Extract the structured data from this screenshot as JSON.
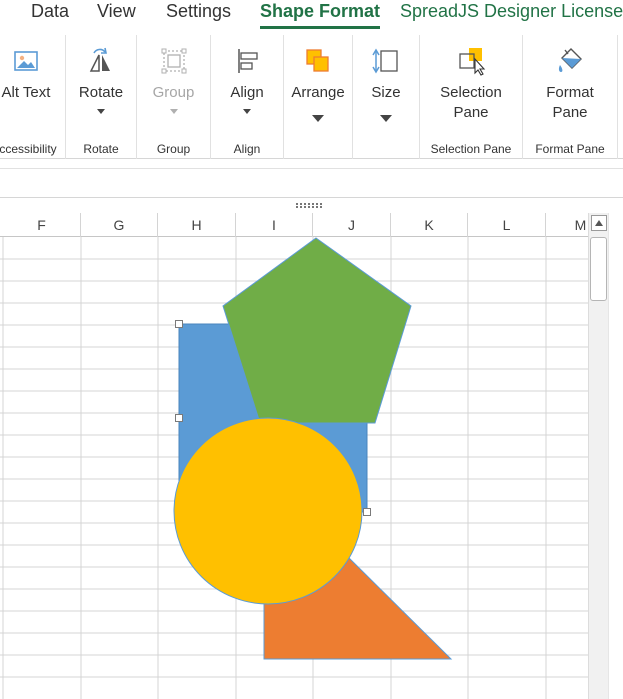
{
  "tabs": {
    "data": "Data",
    "view": "View",
    "settings": "Settings",
    "shape_format": "Shape Format",
    "license": "SpreadJS Designer License"
  },
  "ribbon": {
    "alt_text": {
      "label": "Alt Text",
      "group": "ccessibility"
    },
    "rotate": {
      "label": "Rotate",
      "group": "Rotate"
    },
    "group": {
      "label": "Group",
      "group": "Group"
    },
    "align": {
      "label": "Align",
      "group": "Align"
    },
    "arrange": {
      "label": "Arrange"
    },
    "size": {
      "label": "Size"
    },
    "selection_pane": {
      "label_line1": "Selection",
      "label_line2": "Pane",
      "group": "Selection Pane"
    },
    "format_pane": {
      "label_line1": "Format",
      "label_line2": "Pane",
      "group": "Format Pane"
    }
  },
  "sheet": {
    "columns": [
      "F",
      "G",
      "H",
      "I",
      "J",
      "K",
      "L",
      "M"
    ],
    "shapes": [
      {
        "type": "rectangle",
        "fill": "#5B9BD5",
        "selected": true
      },
      {
        "type": "pentagon",
        "fill": "#70AD47"
      },
      {
        "type": "right-triangle",
        "fill": "#ED7D31"
      },
      {
        "type": "ellipse",
        "fill": "#FFC000"
      }
    ]
  },
  "colors": {
    "accent": "#217346",
    "shape_outline": "#5B9BD5",
    "grid": "#D4D4D4"
  }
}
